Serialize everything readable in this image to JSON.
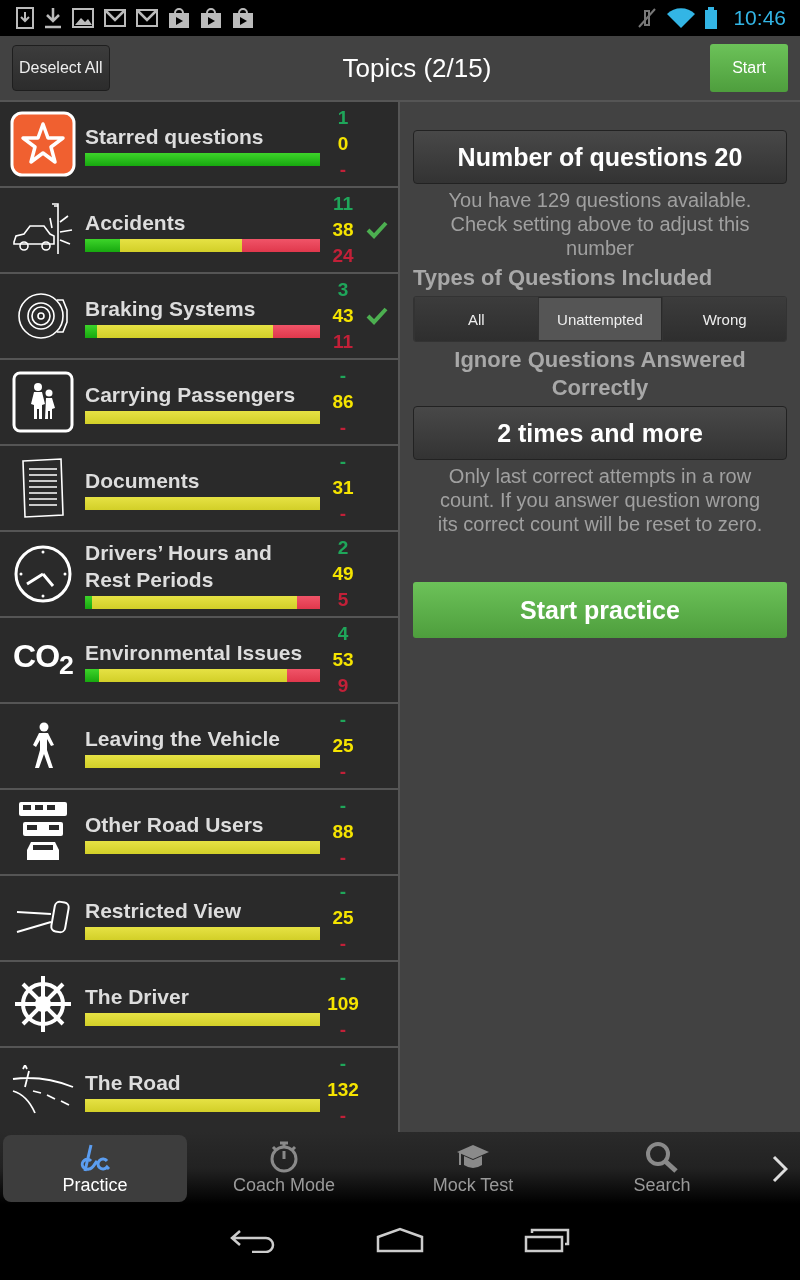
{
  "status_bar": {
    "time": "10:46"
  },
  "top_bar": {
    "deselect_button": "Deselect All",
    "title": "Topics (2/15)",
    "start_button": "Start"
  },
  "topics": [
    {
      "title": "Starred questions",
      "correct": "1",
      "unanswered": "0",
      "wrong": "-",
      "selected": false,
      "bar": [
        {
          "kind": "correct",
          "level": 1
        }
      ]
    },
    {
      "title": "Accidents",
      "correct": "11",
      "unanswered": "38",
      "wrong": "24",
      "selected": true,
      "bar": [
        {
          "kind": "wrong",
          "level": 1
        },
        {
          "kind": "unanswered",
          "level": 0.67
        },
        {
          "kind": "correct",
          "level": 0.15
        }
      ]
    },
    {
      "title": "Braking Systems",
      "correct": "3",
      "unanswered": "43",
      "wrong": "11",
      "selected": true,
      "bar": [
        {
          "kind": "wrong",
          "level": 1
        },
        {
          "kind": "unanswered",
          "level": 0.8
        },
        {
          "kind": "correct",
          "level": 0.05
        }
      ]
    },
    {
      "title": "Carrying Passengers",
      "correct": "-",
      "unanswered": "86",
      "wrong": "-",
      "selected": false,
      "bar": [
        {
          "kind": "unanswered",
          "level": 1
        }
      ]
    },
    {
      "title": "Documents",
      "correct": "-",
      "unanswered": "31",
      "wrong": "-",
      "selected": false,
      "bar": [
        {
          "kind": "unanswered",
          "level": 1
        }
      ]
    },
    {
      "title": "Drivers’ Hours and Rest Periods",
      "correct": "2",
      "unanswered": "49",
      "wrong": "5",
      "selected": false,
      "bar": [
        {
          "kind": "wrong",
          "level": 1
        },
        {
          "kind": "unanswered",
          "level": 0.9
        },
        {
          "kind": "correct",
          "level": 0.03
        }
      ]
    },
    {
      "title": "Environmental Issues",
      "icon_text": "CO$_{2}$",
      "correct": "4",
      "unanswered": "53",
      "wrong": "9",
      "selected": false,
      "bar": [
        {
          "kind": "wrong",
          "level": 1
        },
        {
          "kind": "unanswered",
          "level": 0.86
        },
        {
          "kind": "correct",
          "level": 0.06
        }
      ]
    },
    {
      "title": "Leaving the Vehicle",
      "correct": "-",
      "unanswered": "25",
      "wrong": "-",
      "selected": false,
      "bar": [
        {
          "kind": "unanswered",
          "level": 1
        }
      ]
    },
    {
      "title": "Other Road Users",
      "correct": "-",
      "unanswered": "88",
      "wrong": "-",
      "selected": false,
      "bar": [
        {
          "kind": "unanswered",
          "level": 1
        }
      ]
    },
    {
      "title": "Restricted View",
      "correct": "-",
      "unanswered": "25",
      "wrong": "-",
      "selected": false,
      "bar": [
        {
          "kind": "unanswered",
          "level": 1
        }
      ]
    },
    {
      "title": "The Driver",
      "correct": "-",
      "unanswered": "109",
      "wrong": "-",
      "selected": false,
      "bar": [
        {
          "kind": "unanswered",
          "level": 1
        }
      ]
    },
    {
      "title": "The Road",
      "correct": "-",
      "unanswered": "132",
      "wrong": "-",
      "selected": false,
      "bar": [
        {
          "kind": "unanswered",
          "level": 1
        }
      ]
    }
  ],
  "settings": {
    "number_button": "Number of questions  20",
    "available_note": "You have 129 questions available. Check setting above to adjust this number",
    "types_heading": "Types of Questions Included",
    "types": [
      {
        "label": "All",
        "selected": false
      },
      {
        "label": "Unattempted",
        "selected": true
      },
      {
        "label": "Wrong",
        "selected": false
      }
    ],
    "ignore_heading": "Ignore Questions Answered Correctly",
    "ignore_button": "2 times and more",
    "ignore_note": "Only last correct attempts in a row count. If you answer question wrong its correct count will be reset to zero.",
    "start_button": "Start practice"
  },
  "bottom_tabs": [
    {
      "label": "Practice",
      "selected": true
    },
    {
      "label": "Coach Mode",
      "selected": false
    },
    {
      "label": "Mock Test",
      "selected": false
    },
    {
      "label": "Search",
      "selected": false
    }
  ]
}
